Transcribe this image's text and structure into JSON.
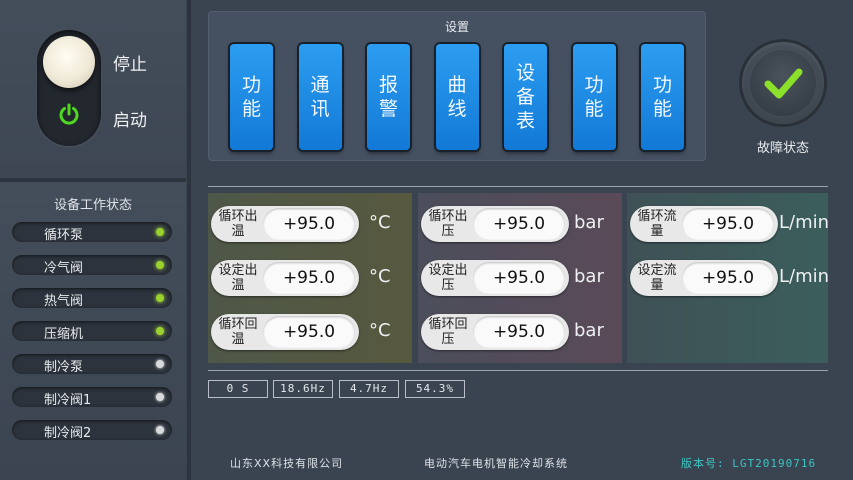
{
  "control": {
    "stop_label": "停止",
    "start_label": "启动"
  },
  "device_status": {
    "title": "设备工作状态",
    "items": [
      {
        "label": "循环泵",
        "state": "on"
      },
      {
        "label": "冷气阀",
        "state": "on"
      },
      {
        "label": "热气阀",
        "state": "on"
      },
      {
        "label": "压缩机",
        "state": "on"
      },
      {
        "label": "制冷泵",
        "state": "off"
      },
      {
        "label": "制冷阀1",
        "state": "off"
      },
      {
        "label": "制冷阀2",
        "state": "off"
      }
    ]
  },
  "settings": {
    "title": "设置",
    "buttons": [
      {
        "label": "功能"
      },
      {
        "label": "通讯"
      },
      {
        "label": "报警"
      },
      {
        "label": "曲线"
      },
      {
        "label": "设备表"
      },
      {
        "label": "功能"
      },
      {
        "label": "功能"
      }
    ]
  },
  "fault": {
    "label": "故障状态",
    "icon": "checkmark-icon",
    "color": "#8be02a"
  },
  "params": {
    "temperature": {
      "unit": "°C",
      "rows": [
        {
          "name": "循环出温",
          "value": "+95.0"
        },
        {
          "name": "设定出温",
          "value": "+95.0"
        },
        {
          "name": "循环回温",
          "value": "+95.0"
        }
      ]
    },
    "pressure": {
      "unit": "bar",
      "rows": [
        {
          "name": "循环出压",
          "value": "+95.0"
        },
        {
          "name": "设定出压",
          "value": "+95.0"
        },
        {
          "name": "循环回压",
          "value": "+95.0"
        }
      ]
    },
    "flow": {
      "unit": "L/min",
      "rows": [
        {
          "name": "循环流量",
          "value": "+95.0"
        },
        {
          "name": "设定流量",
          "value": "+95.0"
        }
      ]
    }
  },
  "info": [
    "0 S",
    "18.6Hz",
    "4.7Hz",
    "54.3%"
  ],
  "footer": {
    "company": "山东XX科技有限公司",
    "system": "电动汽车电机智能冷却系统",
    "version": "版本号: LGT20190716"
  },
  "colors": {
    "accent_blue": "#1a88e6",
    "status_on": "#9bd12e",
    "version_text": "#3bc6c4"
  }
}
